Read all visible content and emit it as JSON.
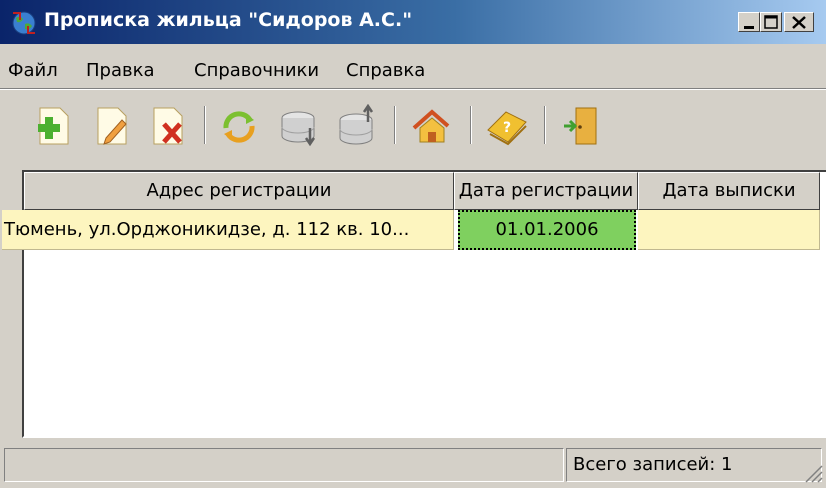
{
  "window": {
    "title": "Прописка жильца \"Сидоров А.С.\"",
    "controls": [
      "minimize-icon",
      "maximize-icon",
      "close-icon"
    ]
  },
  "menu": {
    "items": [
      "Файл",
      "Правка",
      "Справочники",
      "Справка"
    ]
  },
  "toolbar": {
    "buttons": [
      {
        "icon": "add-record-icon"
      },
      {
        "icon": "edit-record-icon"
      },
      {
        "icon": "delete-record-icon"
      },
      {
        "icon": "refresh-icon"
      },
      {
        "icon": "database-import-icon"
      },
      {
        "icon": "database-export-icon"
      },
      {
        "icon": "home-icon"
      },
      {
        "icon": "help-book-icon"
      },
      {
        "icon": "exit-door-icon"
      }
    ]
  },
  "grid": {
    "columns": [
      "Адрес регистрации",
      "Дата регистрации",
      "Дата выписки"
    ],
    "rows": [
      {
        "address": "Тюмень, ул.Орджоникидзе, д. 112 кв. 10...",
        "reg_date": "01.01.2006",
        "checkout_date": ""
      }
    ]
  },
  "statusbar": {
    "left": "",
    "total": "Всего записей: 1"
  },
  "colors": {
    "title_gradient_start": "#0a246a",
    "title_gradient_end": "#a6caf0",
    "row_background": "#fdf5bf",
    "selected_cell": "#7fd05f",
    "window_face": "#d4d0c8"
  }
}
